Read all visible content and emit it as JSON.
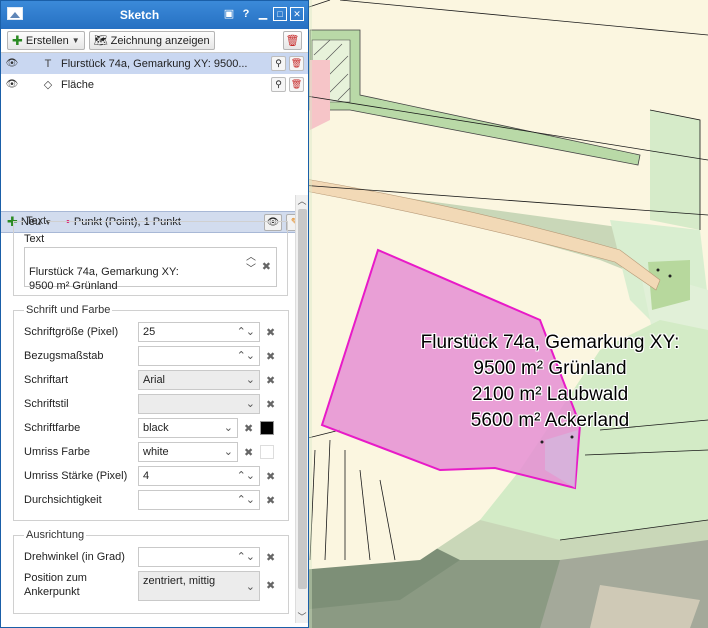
{
  "map": {
    "label_lines": [
      "Flurstück 74a, Gemarkung XY:",
      "9500 m² Grünland",
      "2100 m² Laubwald",
      "5600 m² Ackerland"
    ]
  },
  "panel": {
    "title": "Sketch",
    "toolbar": {
      "create_label": "Erstellen",
      "show_drawing_label": "Zeichnung anzeigen"
    },
    "list": [
      {
        "type_icon": "T",
        "label": "Flurstück 74a, Gemarkung XY: 9500...",
        "selected": true
      },
      {
        "type_icon": "◇",
        "label": "Fläche",
        "selected": false
      }
    ],
    "props_header": {
      "new_label": "Neu",
      "label": "Punkt (Point), 1 Punkt"
    },
    "text_section": {
      "legend": "Text",
      "field_label": "Text",
      "value": "Flurstück 74a, Gemarkung XY:\n9500 m² Grünland"
    },
    "font_section": {
      "legend": "Schrift und Farbe",
      "font_size": {
        "label": "Schriftgröße (Pixel)",
        "value": "25"
      },
      "scale": {
        "label": "Bezugsmaßstab",
        "value": ""
      },
      "font": {
        "label": "Schriftart",
        "value": "Arial"
      },
      "style": {
        "label": "Schriftstil",
        "value": ""
      },
      "color": {
        "label": "Schriftfarbe",
        "value": "black",
        "swatch": "#000000"
      },
      "outline_color": {
        "label": "Umriss Farbe",
        "value": "white",
        "swatch": "#ffffff"
      },
      "outline_width": {
        "label": "Umriss Stärke (Pixel)",
        "value": "4"
      },
      "transparency": {
        "label": "Durchsichtigkeit",
        "value": ""
      }
    },
    "align_section": {
      "legend": "Ausrichtung",
      "rotation": {
        "label": "Drehwinkel (in Grad)",
        "value": ""
      },
      "anchor": {
        "label": "Position zum Ankerpunkt",
        "value": "zentriert, mittig"
      }
    }
  },
  "colors": {
    "accent": "#2670c2",
    "polygon_fill": "#e58fd3",
    "polygon_stroke": "#e81ac8",
    "parcel": "#fbf6e0"
  }
}
